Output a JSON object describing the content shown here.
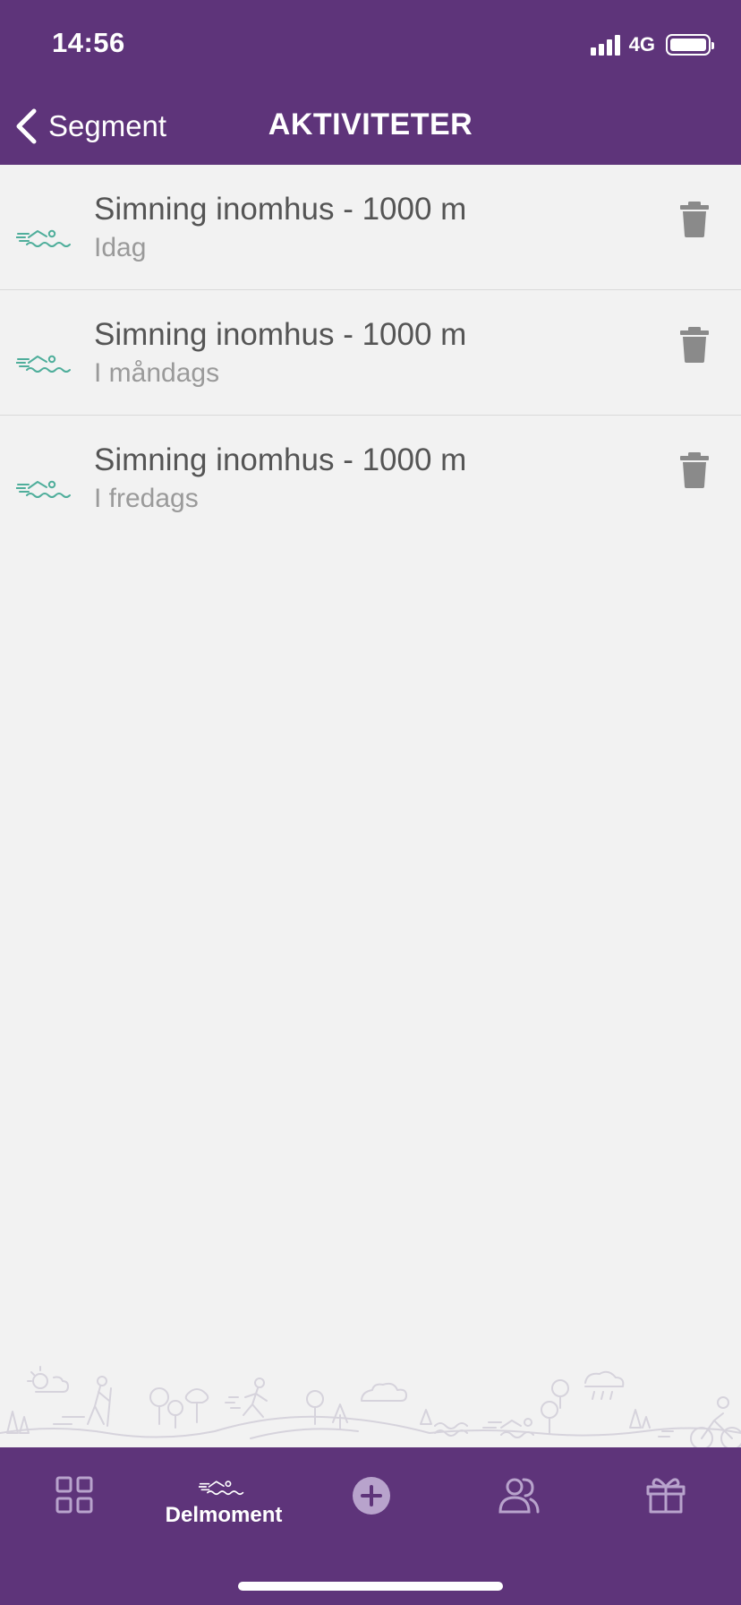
{
  "status_bar": {
    "time": "14:56",
    "network": "4G",
    "signal_icon": "signal-bars-icon",
    "battery_icon": "battery-icon"
  },
  "nav": {
    "back_label": "Segment",
    "back_icon": "chevron-left-icon",
    "title": "AKTIVITETER"
  },
  "activities": [
    {
      "title": "Simning inomhus - 1000 m",
      "subtitle": "Idag",
      "icon": "swimmer-icon",
      "action_icon": "trash-icon"
    },
    {
      "title": "Simning inomhus - 1000 m",
      "subtitle": "I måndags",
      "icon": "swimmer-icon",
      "action_icon": "trash-icon"
    },
    {
      "title": "Simning inomhus - 1000 m",
      "subtitle": "I fredags",
      "icon": "swimmer-icon",
      "action_icon": "trash-icon"
    }
  ],
  "tabbar": {
    "active_label": "Delmoment",
    "tabs": [
      {
        "icon": "grid-icon"
      },
      {
        "icon": "swimmer-icon",
        "label": "Delmoment"
      },
      {
        "icon": "plus-circle-icon"
      },
      {
        "icon": "people-icon"
      },
      {
        "icon": "gift-icon"
      }
    ]
  },
  "colors": {
    "brand_purple": "#5e347a",
    "swim_icon_teal": "#4fae9b",
    "background": "#f2f2f2",
    "title_text": "#555555",
    "subtitle_text": "#9a9a9a",
    "trash_gray": "#8a8a8a",
    "tab_icon_inactive": "#b8a3cc"
  }
}
